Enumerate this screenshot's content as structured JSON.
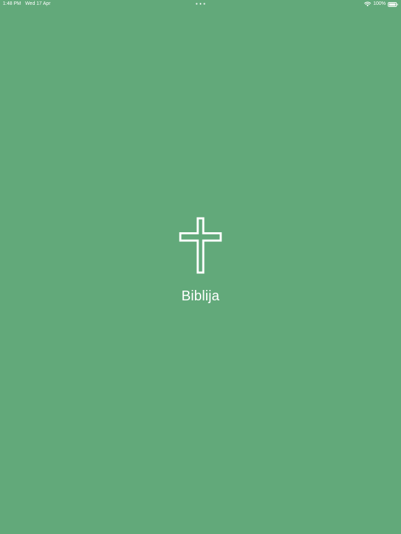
{
  "status_bar": {
    "time": "1:48 PM",
    "date": "Wed 17 Apr",
    "battery": "100%",
    "icons": [
      "wifi-icon",
      "battery-icon",
      "multitask-dots-icon"
    ]
  },
  "splash": {
    "icon": "cross-icon",
    "title": "Biblija"
  },
  "colors": {
    "background": "#62a97a",
    "foreground": "#ffffff"
  }
}
